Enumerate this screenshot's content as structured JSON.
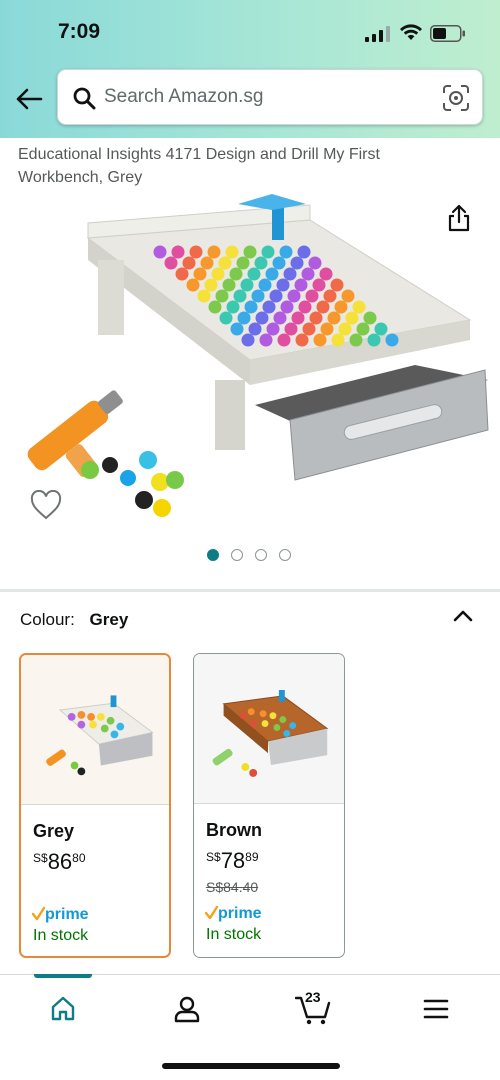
{
  "status_bar": {
    "time": "7:09"
  },
  "search": {
    "placeholder": "Search Amazon.sg"
  },
  "product": {
    "title": "Educational Insights 4171 Design and Drill My First Workbench, Grey",
    "image_count": 4,
    "active_image": 1
  },
  "colour": {
    "label": "Colour:",
    "selected": "Grey"
  },
  "variants": [
    {
      "name": "Grey",
      "currency": "S$",
      "price_whole": "86",
      "price_fraction": "80",
      "was_price": "",
      "prime": "prime",
      "availability": "In stock",
      "selected": true
    },
    {
      "name": "Brown",
      "currency": "S$",
      "price_whole": "78",
      "price_fraction": "89",
      "was_price": "S$84.40",
      "prime": "prime",
      "availability": "In stock",
      "selected": false
    }
  ],
  "nav": {
    "cart_count": "23"
  },
  "colors": {
    "accent": "#0e7c86",
    "selected_border": "#e8893a",
    "in_stock": "#007600",
    "prime_blue": "#1399d6",
    "prime_check": "#f6a11a"
  },
  "icons": [
    "back-arrow-icon",
    "search-icon",
    "camera-lens-icon",
    "share-icon",
    "heart-icon",
    "chevron-up-icon",
    "home-icon",
    "account-icon",
    "cart-icon",
    "menu-icon"
  ]
}
